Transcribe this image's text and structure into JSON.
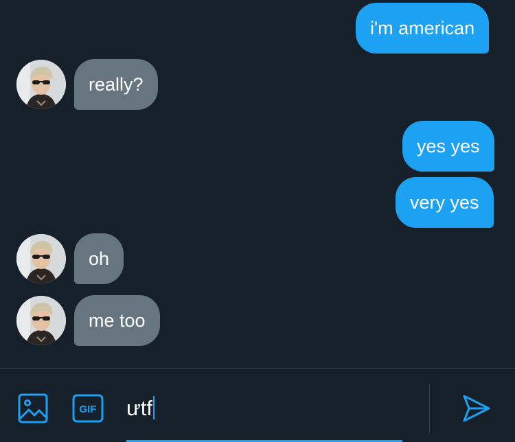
{
  "messages": [
    {
      "direction": "sent",
      "text": "i'm american"
    },
    {
      "direction": "received",
      "text": "really?"
    },
    {
      "direction": "sent",
      "text": "yes yes"
    },
    {
      "direction": "sent",
      "text": "very yes"
    },
    {
      "direction": "received",
      "text": "oh"
    },
    {
      "direction": "received",
      "text": "me too"
    }
  ],
  "composer": {
    "input_value": "ưtf",
    "image_icon": "image-icon",
    "gif_icon": "gif-icon",
    "gif_label": "GIF",
    "send_icon": "send-icon"
  },
  "colors": {
    "background": "#15202b",
    "sent_bubble": "#1da1f2",
    "received_bubble": "#66757f",
    "accent": "#1da1f2",
    "divider": "#38444d"
  }
}
